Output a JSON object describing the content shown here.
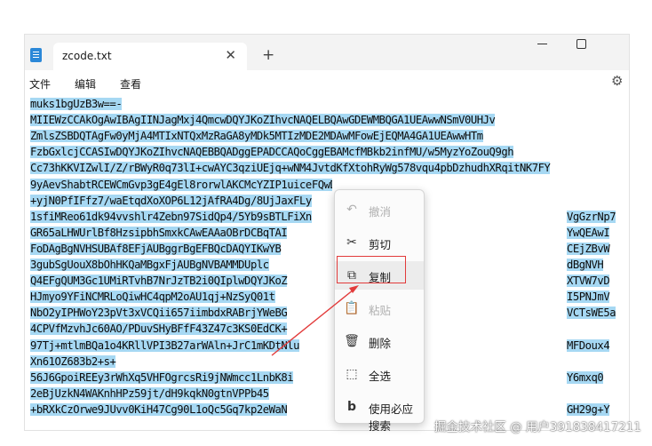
{
  "tab": {
    "title": "zcode.txt",
    "close_icon": "✕",
    "new_tab_icon": "+"
  },
  "menubar": {
    "items": [
      "文件",
      "编辑",
      "查看"
    ],
    "settings_icon": "⚙"
  },
  "editor": {
    "lines": [
      "muks1bgUzB3w==-",
      "MIIEWzCCAkOgAwIBAgIINJagMxj4QmcwDQYJKoZIhvcNAQELBQAwGDEWMBQGA1UEAwwNSmV0UHJv",
      "ZmlsZSBDQTAgFw0yMjA4MTIxNTQxMzRaGA8yMDk5MTIzMDE2MDAwMFowEjEQMA4GA1UEAwwHTm",
      "FzbGxlcjCCASIwDQYJKoZIhvcNAQEBBQADggEPADCCAQoCggEBAMcfMBkb2infMU/w5MyzYoZouQ9gh",
      "Cc73hKKVIZwlI/Z/rBWyR0q73lI+cwAYC3qziUEjq+wNM4JvtdKfXtohRyWg578vqu4pbDzhudhXRqitNK7FY",
      "9yAevShabtRCEWCmGvp3gE4gEl8rorwlAKCMcYZIP1uiceFQwDssO0iQ6WhvUQ3ViI/VcH3",
      "+yjN0PfIFfz7/waEtqdXoXOP6L12jAfRA4Dg/8UjJaxFLy",
      "1sfiMReo61dk94vvshlr4Zebn97SidQp4/5Yb9sBTLFiXn",
      "GR65aLHWUrlBf8HzsipbhSmxkCAwEAAaOBrDCBqTAI",
      "FoDAgBgNVHSUBAf8EFjAUBggrBgEFBQcDAQYIKwYB",
      "3gubSgUouX8bOhHKQaMBgxFjAUBgNVBAMMDUplc",
      "Q4EFgQUM3Gc1UMiRTvhB7NrJzTB2i0QIplwDQYJKoZ",
      "HJmyo9YFiNCMRLoQiwHC4qpM2oAU1qj+NzSyQ01t",
      "NbO2yIPHWoY23pVt3xVCQii657iimbdxRABrjYWeBG",
      "4CPVfMzvhJc60AO/PDuvSHyBFfF43Z47c3KS0EdCK+",
      "97Tj+mtlmBQa1o4KRllVPI3B27arWAln+JrC1mKDtNlu",
      "Xn61OZ683b2+s+",
      "56J6GpoiREEy3rWhXq5VHFOgrcsRi9jNWmcc1LnbK8i",
      "2eBjUzkN4WAKnhHPz59jt/dH9kqkN0gtnVPPb45",
      "+bRXkCzOrwe9JUvv0KiH47Cg90L1oQc5Gq7kp2eWaN"
    ],
    "right_fragments": [
      {
        "line": 7,
        "text": "VgGzrNp7"
      },
      {
        "line": 8,
        "text": "YwQEAwI"
      },
      {
        "line": 9,
        "text": "CEjZBvW"
      },
      {
        "line": 10,
        "text": "dBgNVH"
      },
      {
        "line": 11,
        "text": "XTVW7vD"
      },
      {
        "line": 12,
        "text": "I5PNJmV"
      },
      {
        "line": 13,
        "text": "VCTsWE5a"
      },
      {
        "line": 15,
        "text": "MFDoux4"
      },
      {
        "line": 17,
        "text": "Y6mxq0"
      },
      {
        "line": 19,
        "text": "GH29g+Y"
      }
    ]
  },
  "context_menu": {
    "items": [
      {
        "label": "撤消",
        "icon": "↶",
        "disabled": true
      },
      {
        "label": "剪切",
        "icon": "✂",
        "disabled": false
      },
      {
        "label": "复制",
        "icon": "⧉",
        "disabled": false
      },
      {
        "label": "粘贴",
        "icon": "📋",
        "disabled": true
      },
      {
        "label": "删除",
        "icon": "🗑",
        "disabled": false
      },
      {
        "label": "全选",
        "icon": "⬚",
        "disabled": false
      },
      {
        "label": "使用必应搜索",
        "icon": "b",
        "disabled": false
      }
    ]
  },
  "watermark": "掘金技术社区 @ 用户391838417211",
  "colors": {
    "selection": "#a6d8f3",
    "highlight": "#e23b3b",
    "bing": "#333333"
  }
}
